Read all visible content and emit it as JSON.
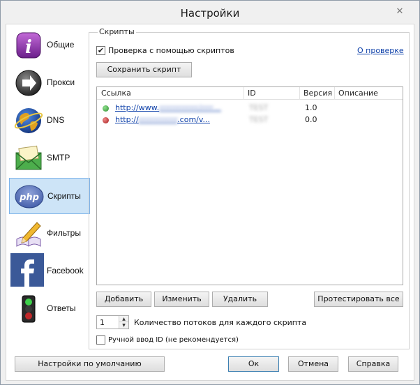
{
  "window": {
    "title": "Настройки",
    "close_glyph": "✕"
  },
  "nav": {
    "items": [
      {
        "label": "Общие",
        "icon": "info-icon"
      },
      {
        "label": "Прокси",
        "icon": "proxy-arrow-icon"
      },
      {
        "label": "DNS",
        "icon": "globe-icon"
      },
      {
        "label": "SMTP",
        "icon": "envelope-icon"
      },
      {
        "label": "Скрипты",
        "icon": "php-icon",
        "selected": true
      },
      {
        "label": "Фильтры",
        "icon": "pencil-book-icon"
      },
      {
        "label": "Facebook",
        "icon": "facebook-icon"
      },
      {
        "label": "Ответы",
        "icon": "traffic-light-icon"
      }
    ]
  },
  "scripts": {
    "group_title": "Скрипты",
    "check_label": "Проверка с помощью скриптов",
    "check_checked": true,
    "about_link": "О проверке",
    "save_button": "Сохранить скрипт",
    "columns": [
      "Ссылка",
      "ID",
      "Версия",
      "Описание"
    ],
    "rows": [
      {
        "status": "#3aa53a",
        "link_prefix": "http://www.",
        "link_rest": "rrrrrrrrrrrrr/rrrr…",
        "id": "TEST",
        "version": "1.0",
        "description": ""
      },
      {
        "status": "#d02a2a",
        "link_prefix": "http://",
        "link_rest": "rrrrrrrrrrrrr",
        "link_suffix": ".com/v...",
        "id": "TEST",
        "version": "0.0",
        "description": ""
      }
    ],
    "buttons": {
      "add": "Добавить",
      "edit": "Изменить",
      "delete": "Удалить",
      "test_all": "Протестировать все"
    },
    "threads_value": "1",
    "threads_label": "Количество потоков для каждого скрипта",
    "manual_id_label": "Ручной ввод ID (не рекомендуется)",
    "manual_id_checked": false
  },
  "footer": {
    "defaults": "Настройки по умолчанию",
    "ok": "Ок",
    "cancel": "Отмена",
    "help": "Справка"
  }
}
